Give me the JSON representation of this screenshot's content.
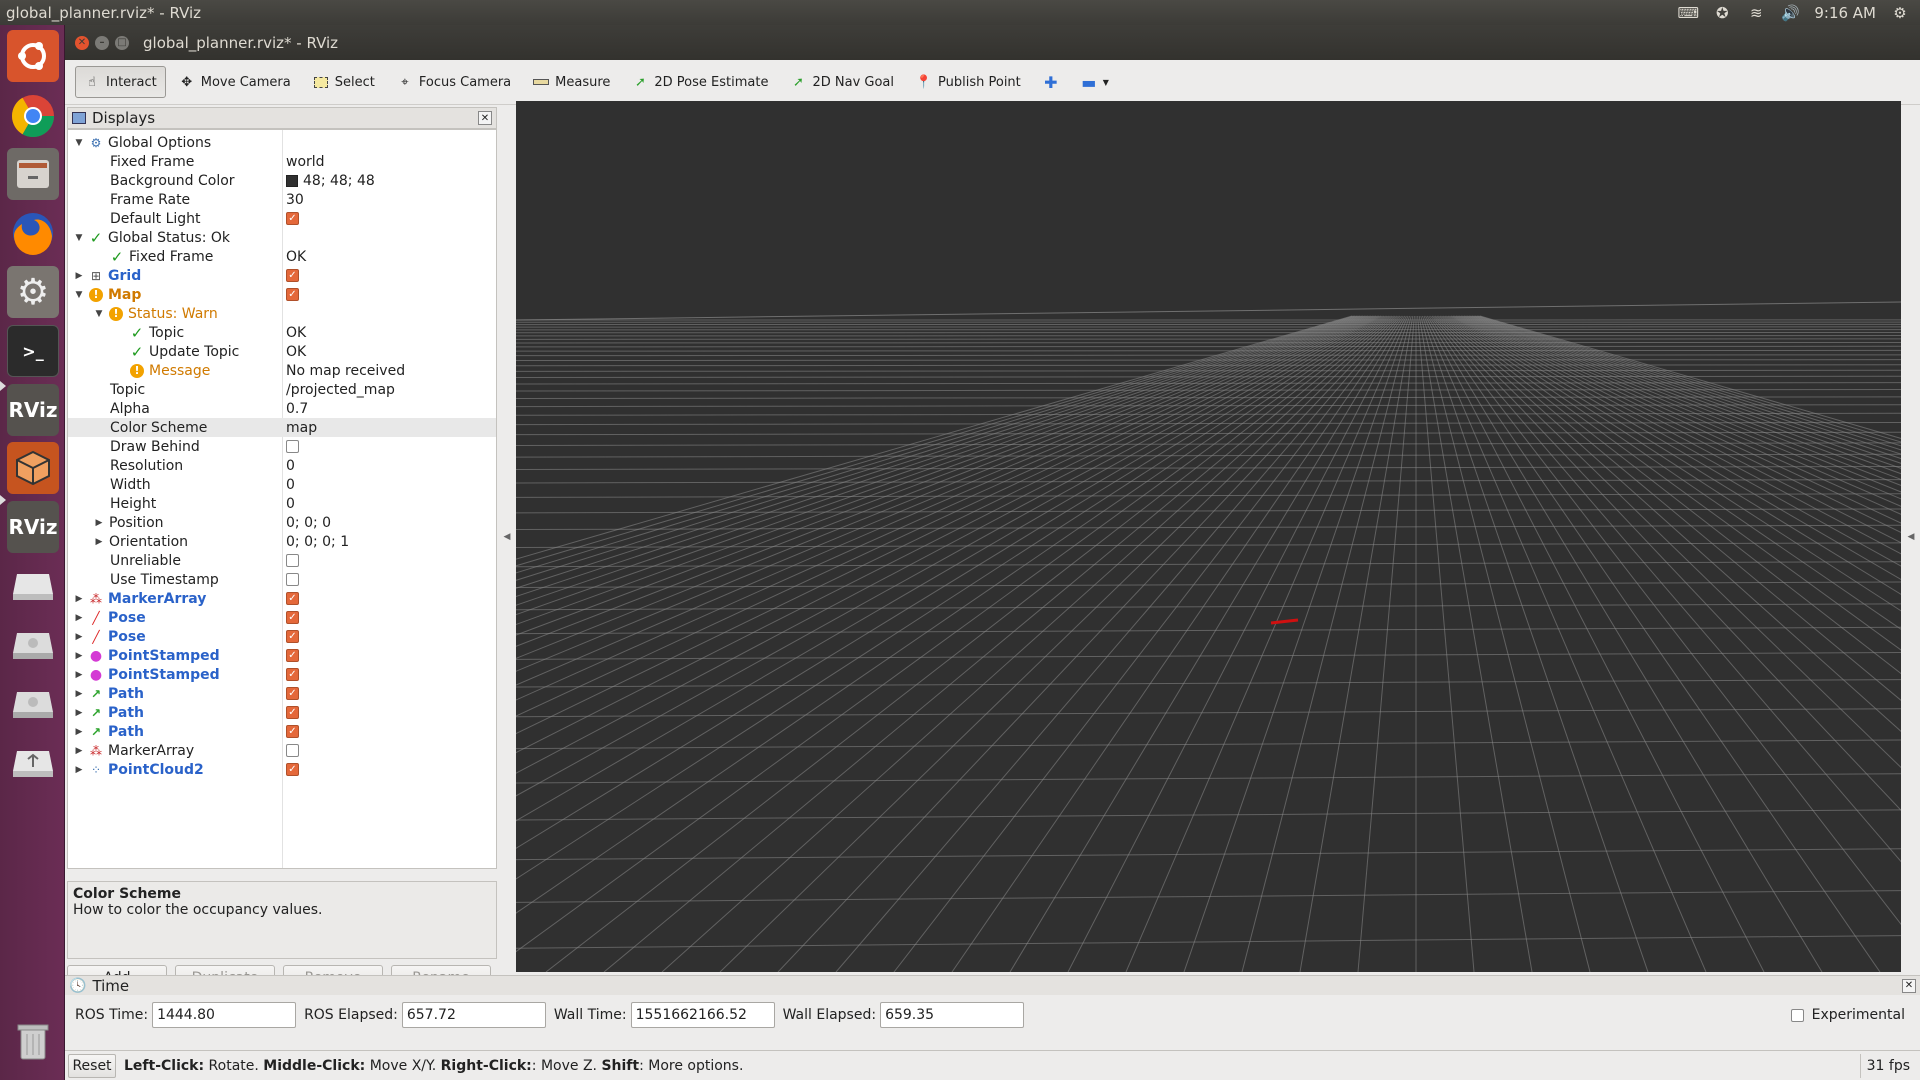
{
  "topbar": {
    "title": "global_planner.rviz* - RViz",
    "time": "9:16 AM"
  },
  "window": {
    "title": "global_planner.rviz* - RViz"
  },
  "toolbar": {
    "tools": [
      "Interact",
      "Move Camera",
      "Select",
      "Focus Camera",
      "Measure",
      "2D Pose Estimate",
      "2D Nav Goal",
      "Publish Point"
    ]
  },
  "displays": {
    "title": "Displays",
    "rows": [
      {
        "name": "Global Options",
        "value": ""
      },
      {
        "name": "Fixed Frame",
        "value": "world"
      },
      {
        "name": "Background Color",
        "value": "48; 48; 48"
      },
      {
        "name": "Frame Rate",
        "value": "30"
      },
      {
        "name": "Default Light",
        "value": ""
      },
      {
        "name": "Global Status: Ok",
        "value": ""
      },
      {
        "name": "Fixed Frame",
        "value": "OK"
      },
      {
        "name": "Grid",
        "value": ""
      },
      {
        "name": "Map",
        "value": ""
      },
      {
        "name": "Status: Warn",
        "value": ""
      },
      {
        "name": "Topic",
        "value": "OK"
      },
      {
        "name": "Update Topic",
        "value": "OK"
      },
      {
        "name": "Message",
        "value": "No map received"
      },
      {
        "name": "Topic",
        "value": "/projected_map"
      },
      {
        "name": "Alpha",
        "value": "0.7"
      },
      {
        "name": "Color Scheme",
        "value": "map"
      },
      {
        "name": "Draw Behind",
        "value": ""
      },
      {
        "name": "Resolution",
        "value": "0"
      },
      {
        "name": "Width",
        "value": "0"
      },
      {
        "name": "Height",
        "value": "0"
      },
      {
        "name": "Position",
        "value": "0; 0; 0"
      },
      {
        "name": "Orientation",
        "value": "0; 0; 0; 1"
      },
      {
        "name": "Unreliable",
        "value": ""
      },
      {
        "name": "Use Timestamp",
        "value": ""
      },
      {
        "name": "MarkerArray",
        "value": ""
      },
      {
        "name": "Pose",
        "value": ""
      },
      {
        "name": "Pose",
        "value": ""
      },
      {
        "name": "PointStamped",
        "value": ""
      },
      {
        "name": "PointStamped",
        "value": ""
      },
      {
        "name": "Path",
        "value": ""
      },
      {
        "name": "Path",
        "value": ""
      },
      {
        "name": "Path",
        "value": ""
      },
      {
        "name": "MarkerArray",
        "value": ""
      },
      {
        "name": "PointCloud2",
        "value": ""
      }
    ],
    "description": {
      "title": "Color Scheme",
      "text": "How to color the occupancy values."
    },
    "buttons": {
      "add": "Add",
      "duplicate": "Duplicate",
      "remove": "Remove",
      "rename": "Rename"
    }
  },
  "time": {
    "title": "Time",
    "ros_time_label": "ROS Time:",
    "ros_time": "1444.80",
    "ros_elapsed_label": "ROS Elapsed:",
    "ros_elapsed": "657.72",
    "wall_time_label": "Wall Time:",
    "wall_time": "1551662166.52",
    "wall_elapsed_label": "Wall Elapsed:",
    "wall_elapsed": "659.35",
    "experimental": "Experimental"
  },
  "status": {
    "reset": "Reset",
    "hint_1": "Left-Click:",
    "hint_2": " Rotate. ",
    "hint_3": "Middle-Click:",
    "hint_4": " Move X/Y. ",
    "hint_5": "Right-Click:",
    "hint_6": ": Move Z. ",
    "hint_7": "Shift",
    "hint_8": ": More options.",
    "fps": "31 fps"
  },
  "launcher": {
    "rviz_label": "RViz"
  }
}
